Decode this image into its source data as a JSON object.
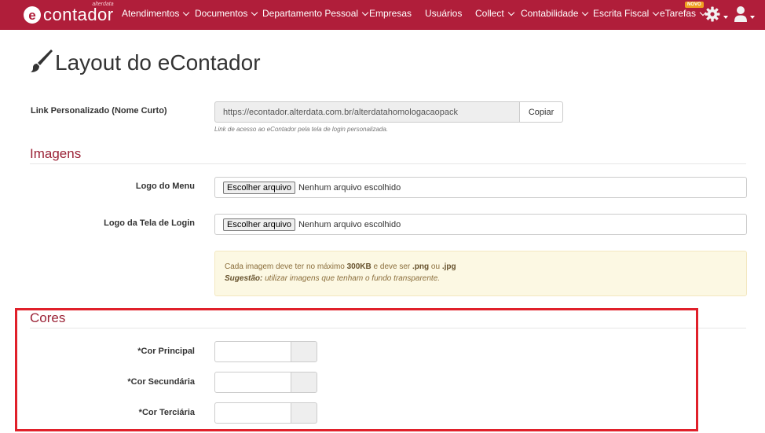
{
  "navbar": {
    "brand_name": "contador",
    "brand_sub": "alterdata",
    "items": [
      {
        "label": "Atendimentos",
        "dropdown": true
      },
      {
        "label": "Documentos",
        "dropdown": true
      },
      {
        "label": "Departamento Pessoal",
        "dropdown": true
      },
      {
        "label": "Empresas",
        "dropdown": false
      },
      {
        "label": "Usuários",
        "dropdown": false
      },
      {
        "label": "Collect",
        "dropdown": true
      },
      {
        "label": "Contabilidade",
        "dropdown": true
      },
      {
        "label": "Escrita Fiscal",
        "dropdown": true
      },
      {
        "label": "eTarefas",
        "dropdown": true
      }
    ],
    "new_badge": "NOVO",
    "settings_icon": "gear-icon",
    "user_icon": "user-icon",
    "color": "#b01e3a"
  },
  "page": {
    "title": "Layout do eContador",
    "title_icon": "paintbrush-icon"
  },
  "link": {
    "label": "Link Personalizado (Nome Curto)",
    "value": "https://econtador.alterdata.com.br/alterdatahomologacaopack",
    "copy_button": "Copiar",
    "help": "Link de acesso ao eContador pela tela de login personalizada."
  },
  "images": {
    "section_title": "Imagens",
    "logo_menu": {
      "label": "Logo do Menu",
      "button": "Escolher arquivo",
      "status": "Nenhum arquivo escolhido"
    },
    "logo_login": {
      "label": "Logo da Tela de Login",
      "button": "Escolher arquivo",
      "status": "Nenhum arquivo escolhido"
    },
    "alert": {
      "line1_pre": "Cada imagem deve ter no máximo ",
      "line1_size": "300KB",
      "line1_mid": " e deve ser ",
      "line1_png": ".png",
      "line1_or": " ou ",
      "line1_jpg": ".jpg",
      "line2_label": "Sugestão:",
      "line2_text": " utilizar imagens que tenham o fundo transparente."
    }
  },
  "colors": {
    "section_title": "Cores",
    "primary_label": "*Cor Principal",
    "secondary_label": "*Cor Secundária",
    "tertiary_label": "*Cor Terciária",
    "accent": "#9b2236",
    "highlight": "#e0202a"
  }
}
